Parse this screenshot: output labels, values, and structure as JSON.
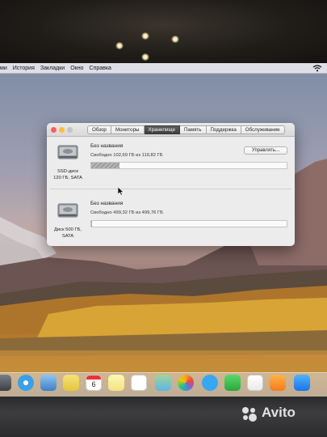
{
  "menubar": {
    "items": [
      "ми",
      "История",
      "Закладки",
      "Окно",
      "Справка"
    ]
  },
  "window": {
    "tabs": [
      {
        "label": "Обзор",
        "active": false
      },
      {
        "label": "Мониторы",
        "active": false
      },
      {
        "label": "Хранилище",
        "active": true
      },
      {
        "label": "Память",
        "active": false
      },
      {
        "label": "Поддержка",
        "active": false
      },
      {
        "label": "Обслуживание",
        "active": false
      }
    ],
    "manage_button": "Управлять...",
    "disks": [
      {
        "icon": "internal-disk-icon",
        "label_line1": "SSD-диск",
        "label_line2": "120 ГБ, SATA",
        "volume_name": "Без названия",
        "free_text": "Свободно 102,69 ГБ из 119,82 ГБ",
        "used_fraction": 0.143
      },
      {
        "icon": "internal-disk-icon",
        "label_line1": "Диск 500 ГБ,",
        "label_line2": "SATA",
        "volume_name": "Без названия",
        "free_text": "Свободно 499,32 ГБ из 499,76 ГБ",
        "used_fraction": 0.001
      }
    ]
  },
  "dock": {
    "calendar_day": "6",
    "icons": [
      "launchpad-icon",
      "safari-icon",
      "preview-icon",
      "notes-icon",
      "calendar-icon",
      "stickies-icon",
      "reminders-icon",
      "maps-icon",
      "photos-icon",
      "messages-icon",
      "facetime-icon",
      "music-icon",
      "books-icon",
      "app-store-icon"
    ]
  },
  "watermark": {
    "text": "Avito"
  },
  "colors": {
    "close": "#fc605b",
    "minimize": "#fdbc40",
    "zoom": "#34c84a",
    "active_tab": "#4a4a4a"
  }
}
